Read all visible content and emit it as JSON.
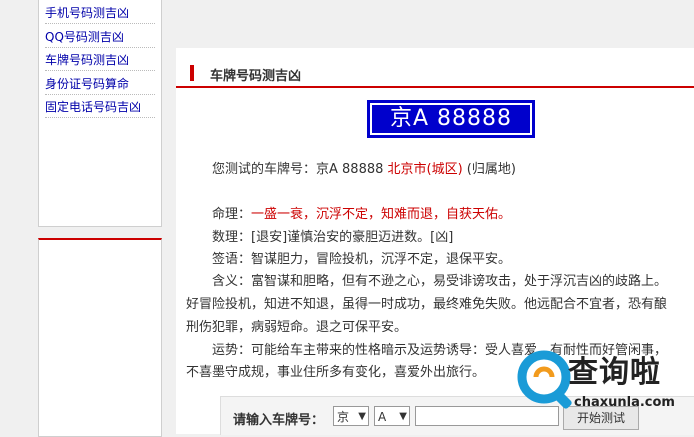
{
  "sidebar": {
    "items": [
      {
        "label": "手机号码测吉凶"
      },
      {
        "label": "QQ号码测吉凶"
      },
      {
        "label": "车牌号码测吉凶"
      },
      {
        "label": "身份证号码算命"
      },
      {
        "label": "固定电话号码吉凶"
      }
    ]
  },
  "section": {
    "title": "车牌号码测吉凶"
  },
  "plate": {
    "number": "京A 88888"
  },
  "result": {
    "test_prefix": "您测试的车牌号：京A 88888 ",
    "test_location": "北京市(城区)",
    "test_suffix": " (归属地)",
    "fate_label": "命理：",
    "fate_value": "一盛一衰，沉浮不定，知难而退，自获天佑。",
    "number_label": "数理：",
    "number_value": "[退安]谨慎治安的豪胆迈进数。[凶]",
    "sign_label": "签语：",
    "sign_value": "智谋胆力，冒险投机，沉浮不定，退保平安。",
    "meaning_label": "含义：",
    "meaning_line1": "富智谋和胆略，但有不逊之心，易受诽谤攻击，处于浮沉吉凶的歧路上。",
    "meaning_line2": "好冒险投机，知进不知退，虽得一时成功，最终难免失败。他远配合不宜者，恐有酿",
    "meaning_line3": "刑伤犯罪，病弱短命。退之可保平安。",
    "fortune_label": "运势：",
    "fortune_line1": "可能给车主带来的性格暗示及运势诱导：受人喜爱，有耐性而好管闲事，",
    "fortune_line2": "不喜墨守成规，事业住所多有变化，喜爱外出旅行。"
  },
  "form": {
    "label": "请输入车牌号：",
    "province_selected": "京",
    "letter_selected": "A",
    "plate_input_value": "",
    "submit_label": "开始测试"
  },
  "watermark": {
    "brand": "查询啦",
    "domain": "chaxunla.com"
  },
  "colors": {
    "accent_red": "#cc0000",
    "plate_blue": "#0000cc",
    "link_blue": "#0000aa"
  }
}
